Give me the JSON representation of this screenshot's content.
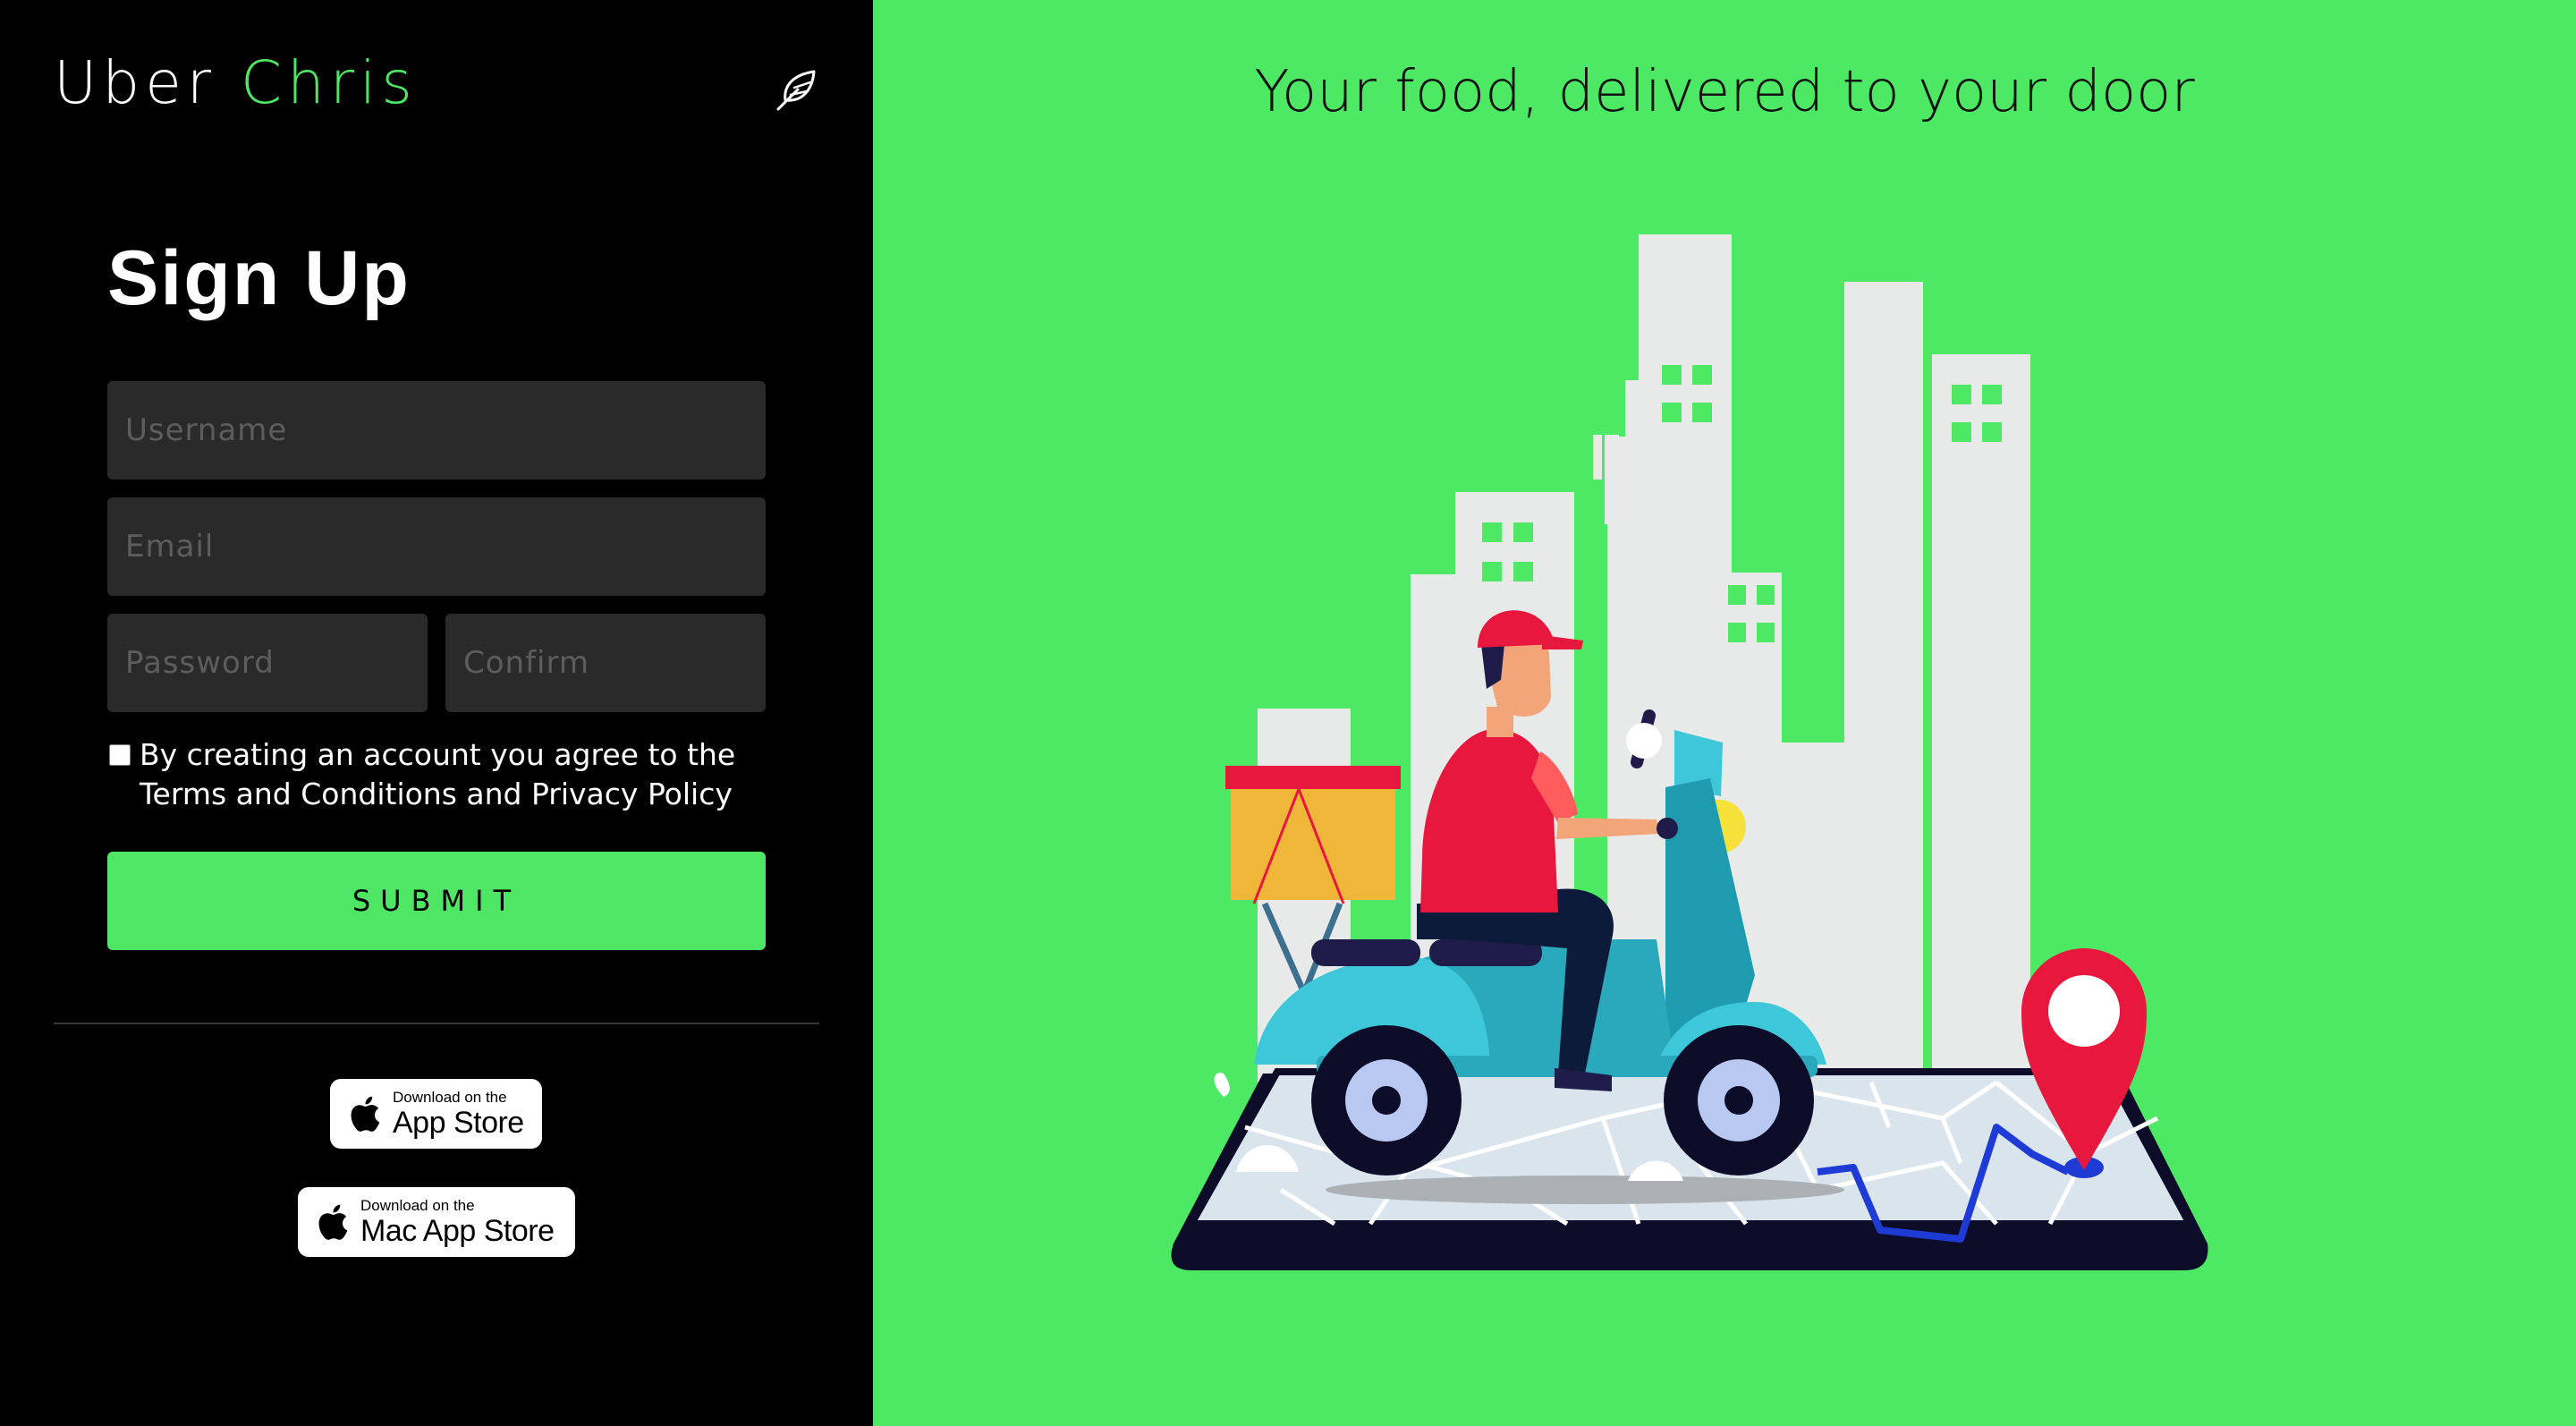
{
  "brand": {
    "name": "Uber",
    "accent": "Chris"
  },
  "icons": {
    "header": "feather-icon",
    "checkbox": "checkbox",
    "apple": "apple-icon"
  },
  "signup": {
    "title": "Sign Up",
    "username_placeholder": "Username",
    "email_placeholder": "Email",
    "password_placeholder": "Password",
    "confirm_placeholder": "Confirm",
    "terms_text": "By creating an account you agree to the Terms and Conditions and Privacy Policy",
    "terms_checked": false,
    "submit_label": "SUBMIT"
  },
  "badges": {
    "app_store": {
      "small": "Download on the",
      "big": "App Store"
    },
    "mac_app_store": {
      "small": "Download on the",
      "big": "Mac App Store"
    }
  },
  "hero": {
    "headline": "Your food, delivered to your door"
  },
  "colors": {
    "accent": "#4ee664",
    "panel_bg": "#000000",
    "hero_bg": "#4de964",
    "input_bg": "#2a2a2a"
  }
}
